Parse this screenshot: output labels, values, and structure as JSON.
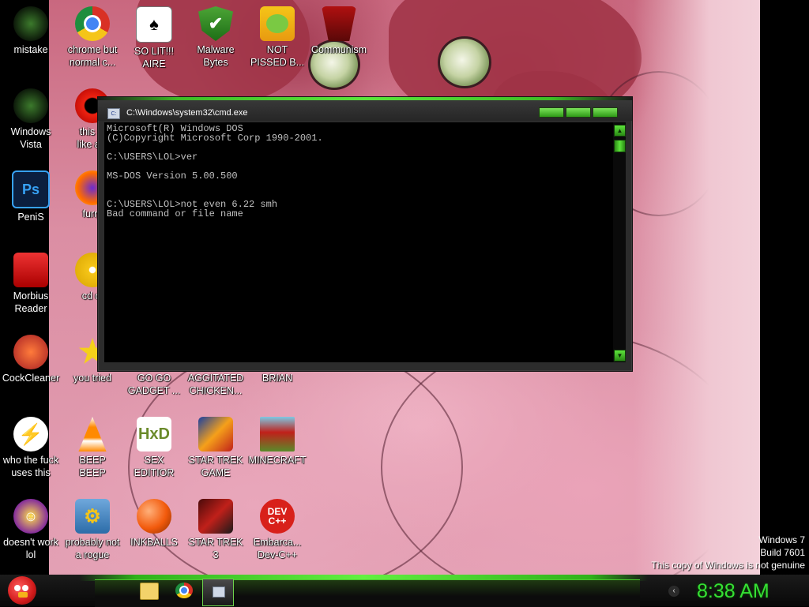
{
  "desktop": {
    "icons": [
      {
        "label": "mistake"
      },
      {
        "label": "Windows\nVista"
      },
      {
        "label": "PeniS",
        "glyph": "Ps"
      },
      {
        "label": "Morbius\nReader"
      },
      {
        "label": "CockCleaner"
      },
      {
        "label": "who the fuck\nuses this"
      },
      {
        "label": "doesn't work\nlol"
      },
      {
        "label": "chrome but\nnormal c..."
      },
      {
        "label": "this lo\nlike a v"
      },
      {
        "label": "furry"
      },
      {
        "label": "cd di"
      },
      {
        "label": "you tried"
      },
      {
        "label": "BEEP\nBEEP"
      },
      {
        "label": "probably not\na rogue"
      },
      {
        "label": "SO LIT!!!\nAIRE"
      },
      {
        "label": "GO GO\nGADGET ..."
      },
      {
        "label": "SEX\nEDITIOR"
      },
      {
        "label": "INKBALLS"
      },
      {
        "label": "Malware\nBytes"
      },
      {
        "label": "AGGITATED\nCHICKEN..."
      },
      {
        "label": "STAR TREK\nGAME"
      },
      {
        "label": "STAR TREK\n3"
      },
      {
        "label": "NOT\nPISSED B..."
      },
      {
        "label": "BRIAN"
      },
      {
        "label": "MINECRAFT"
      },
      {
        "label": "Embarca...\nDev-C++",
        "glyph": "DEV\nC++"
      },
      {
        "label": "Communism"
      }
    ]
  },
  "cmd": {
    "title": "C:\\Windows\\system32\\cmd.exe",
    "lines": [
      "Microsoft(R) Windows DOS",
      "(C)Copyright Microsoft Corp 1990-2001.",
      "",
      "C:\\USERS\\LOL>ver",
      "",
      "MS-DOS Version 5.00.500",
      "",
      "",
      "C:\\USERS\\LOL>not even 6.22 smh",
      "Bad command or file name"
    ]
  },
  "watermark": {
    "line1": "Windows 7",
    "line2": "Build 7601",
    "line3": "This copy of Windows is not genuine"
  },
  "taskbar": {
    "clock": "8:38 AM",
    "tray_arrow": "‹"
  },
  "colors": {
    "accent_green": "#35e034",
    "cmd_text": "#c0c0c0"
  }
}
